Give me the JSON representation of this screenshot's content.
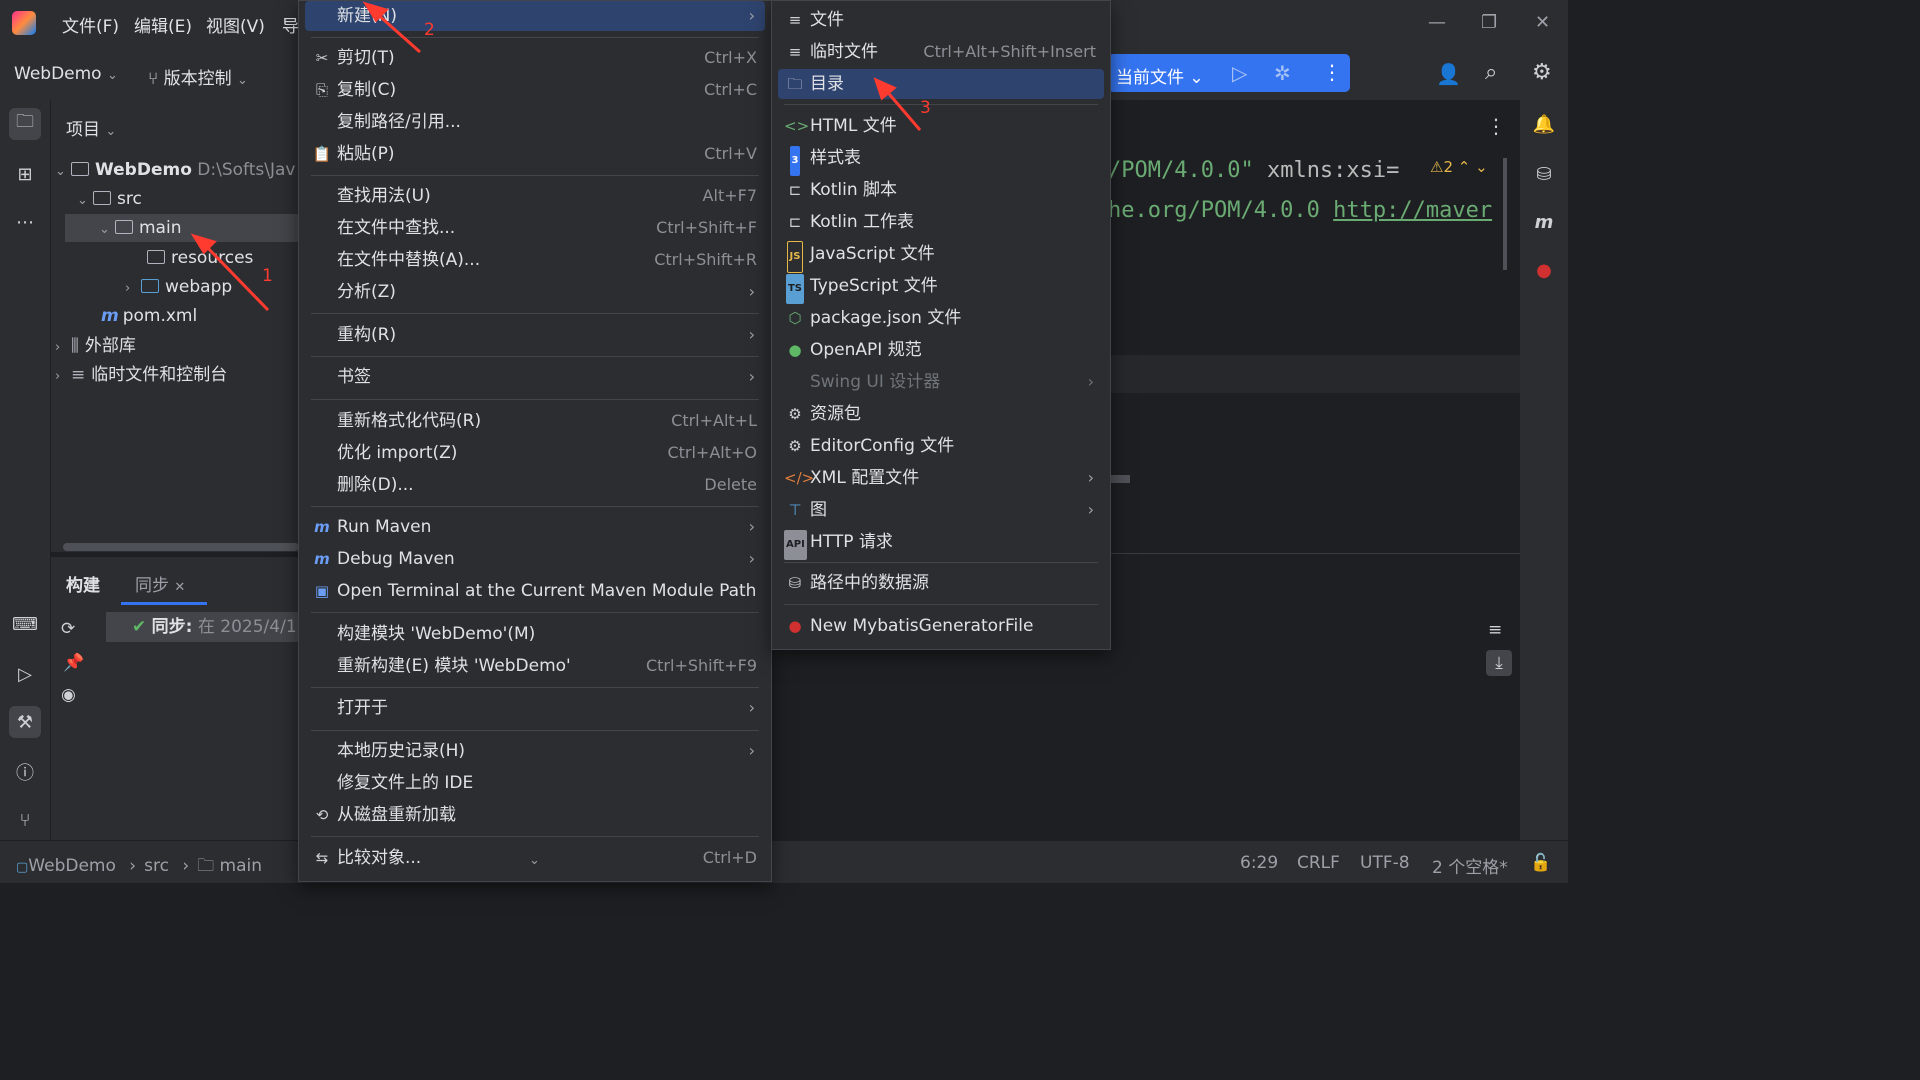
{
  "app": {
    "menu": [
      "文件(F)",
      "编辑(E)",
      "视图(V)",
      "导"
    ],
    "project_name": "WebDemo",
    "vcs": "版本控制",
    "run_config": "当前文件"
  },
  "project_panel": {
    "title": "项目",
    "tree": [
      {
        "label": "WebDemo",
        "extra": "D:\\Softs\\Jav"
      },
      {
        "label": "src"
      },
      {
        "label": "main"
      },
      {
        "label": "resources"
      },
      {
        "label": "webapp"
      },
      {
        "label": "pom.xml"
      },
      {
        "label": "外部库"
      },
      {
        "label": "临时文件和控制台"
      }
    ]
  },
  "build_panel": {
    "tabs": [
      "构建",
      "同步"
    ],
    "sync_label": "同步:",
    "sync_time": "在 2025/4/1"
  },
  "editor": {
    "line1_string": "/POM/4.0.0\"",
    "line1_attr": "xmlns:xsi=",
    "line2_text": "he.org/POM/4.0.0",
    "line2_link": "http://maver",
    "warnings": "2"
  },
  "context_menu": {
    "items": [
      {
        "label": "新建(N)",
        "arrow": true
      },
      {
        "label": "剪切(T)",
        "shortcut": "Ctrl+X",
        "icon": "scissors-icon"
      },
      {
        "label": "复制(C)",
        "shortcut": "Ctrl+C",
        "icon": "copy-icon"
      },
      {
        "label": "复制路径/引用..."
      },
      {
        "label": "粘贴(P)",
        "shortcut": "Ctrl+V",
        "icon": "paste-icon"
      },
      {
        "label": "查找用法(U)",
        "shortcut": "Alt+F7"
      },
      {
        "label": "在文件中查找...",
        "shortcut": "Ctrl+Shift+F"
      },
      {
        "label": "在文件中替换(A)...",
        "shortcut": "Ctrl+Shift+R"
      },
      {
        "label": "分析(Z)",
        "arrow": true
      },
      {
        "label": "重构(R)",
        "arrow": true
      },
      {
        "label": "书签",
        "arrow": true
      },
      {
        "label": "重新格式化代码(R)",
        "shortcut": "Ctrl+Alt+L"
      },
      {
        "label": "优化 import(Z)",
        "shortcut": "Ctrl+Alt+O"
      },
      {
        "label": "删除(D)...",
        "shortcut": "Delete"
      },
      {
        "label": "Run Maven",
        "arrow": true,
        "icon": "maven-run-icon"
      },
      {
        "label": "Debug Maven",
        "arrow": true,
        "icon": "maven-debug-icon"
      },
      {
        "label": "Open Terminal at the Current Maven Module Path",
        "icon": "maven-terminal-icon"
      },
      {
        "label": "构建模块 'WebDemo'(M)"
      },
      {
        "label": "重新构建(E) 模块 'WebDemo'",
        "shortcut": "Ctrl+Shift+F9"
      },
      {
        "label": "打开于",
        "arrow": true
      },
      {
        "label": "本地历史记录(H)",
        "arrow": true
      },
      {
        "label": "修复文件上的 IDE"
      },
      {
        "label": "从磁盘重新加载",
        "icon": "reload-icon"
      },
      {
        "label": "比较对象...",
        "shortcut": "Ctrl+D",
        "icon": "compare-icon"
      }
    ]
  },
  "new_submenu": {
    "items": [
      {
        "label": "文件"
      },
      {
        "label": "临时文件",
        "shortcut": "Ctrl+Alt+Shift+Insert"
      },
      {
        "label": "目录"
      },
      {
        "label": "HTML 文件"
      },
      {
        "label": "样式表"
      },
      {
        "label": "Kotlin 脚本"
      },
      {
        "label": "Kotlin 工作表"
      },
      {
        "label": "JavaScript 文件"
      },
      {
        "label": "TypeScript 文件"
      },
      {
        "label": "package.json 文件"
      },
      {
        "label": "OpenAPI 规范"
      },
      {
        "label": "Swing UI 设计器",
        "disabled": true
      },
      {
        "label": "资源包"
      },
      {
        "label": "EditorConfig 文件"
      },
      {
        "label": "XML 配置文件"
      },
      {
        "label": "图"
      },
      {
        "label": "HTTP 请求"
      },
      {
        "label": "路径中的数据源"
      },
      {
        "label": "New MybatisGeneratorFile"
      }
    ]
  },
  "annotations": [
    "1",
    "2",
    "3"
  ],
  "status_bar": {
    "breadcrumb": [
      "WebDemo",
      "src",
      "main"
    ],
    "position": "6:29",
    "line_sep": "CRLF",
    "encoding": "UTF-8",
    "indent": "2 个空格*"
  },
  "colors": {
    "highlight": "#2e436e",
    "selection": "#43454a",
    "run_widget": "#3574f0",
    "annotation": "#ff3b30"
  }
}
